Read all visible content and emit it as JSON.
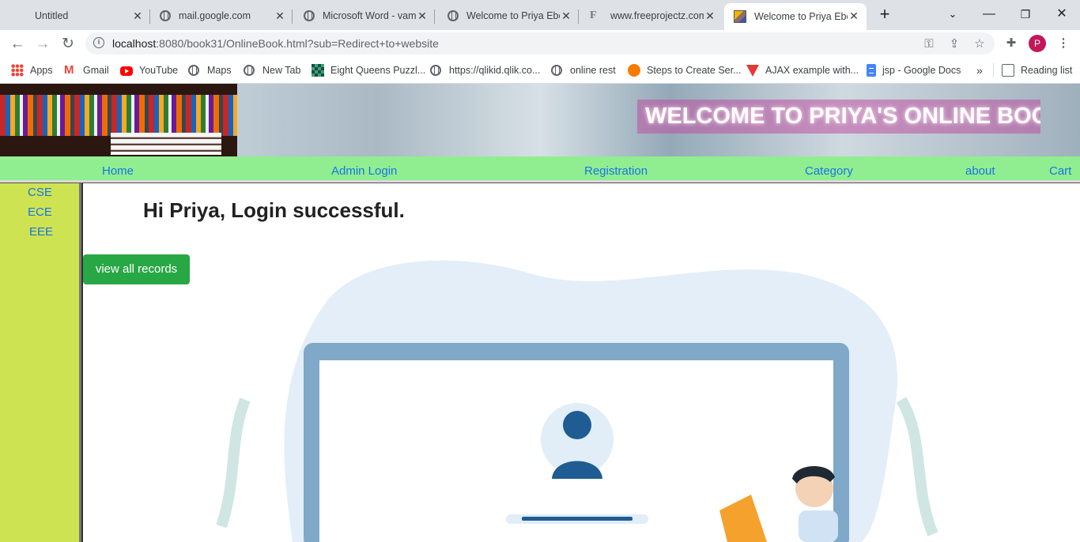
{
  "browser": {
    "tabs": [
      {
        "title": "Untitled",
        "icon": "none"
      },
      {
        "title": "mail.google.com",
        "icon": "globe-icon"
      },
      {
        "title": "Microsoft Word - vam",
        "icon": "globe-icon"
      },
      {
        "title": "Welcome to Priya Ebo",
        "icon": "globe-icon"
      },
      {
        "title": "www.freeprojectz.com",
        "icon": "f-logo-icon"
      },
      {
        "title": "Welcome to Priya Ebo",
        "icon": "book-icon",
        "active": true
      }
    ],
    "url_host": "localhost",
    "url_rest": ":8080/book31/OnlineBook.html?sub=Redirect+to+website",
    "profile_initial": "P",
    "bookmarks": [
      {
        "label": "Apps",
        "icon": "apps-grid-icon"
      },
      {
        "label": "Gmail",
        "icon": "gmail-icon"
      },
      {
        "label": "YouTube",
        "icon": "youtube-icon"
      },
      {
        "label": "Maps",
        "icon": "globe-icon"
      },
      {
        "label": "New Tab",
        "icon": "globe-icon"
      },
      {
        "label": "Eight Queens Puzzl...",
        "icon": "chessboard-icon"
      },
      {
        "label": "https://qlikid.qlik.co...",
        "icon": "globe-icon"
      },
      {
        "label": "online rest",
        "icon": "globe-icon"
      },
      {
        "label": "Steps to Create Ser...",
        "icon": "steps-icon"
      },
      {
        "label": "AJAX example with...",
        "icon": "ajax-icon"
      },
      {
        "label": "jsp - Google Docs",
        "icon": "docs-icon"
      }
    ],
    "more_bookmarks": "»",
    "reading_list": "Reading list"
  },
  "site": {
    "banner_title": "WELCOME TO PRIYA'S ONLINE BOOK",
    "menu": [
      "Home",
      "Admin Login",
      "Registration",
      "Category",
      "about",
      "Cart"
    ],
    "sidebar": [
      "CSE",
      "ECE",
      "EEE"
    ],
    "greeting": "Hi Priya, Login successful.",
    "view_button": "view all records"
  },
  "colors": {
    "menubar": "#90ee90",
    "sidebar": "#cde351",
    "link": "#1a73e8",
    "button": "#28a745"
  }
}
